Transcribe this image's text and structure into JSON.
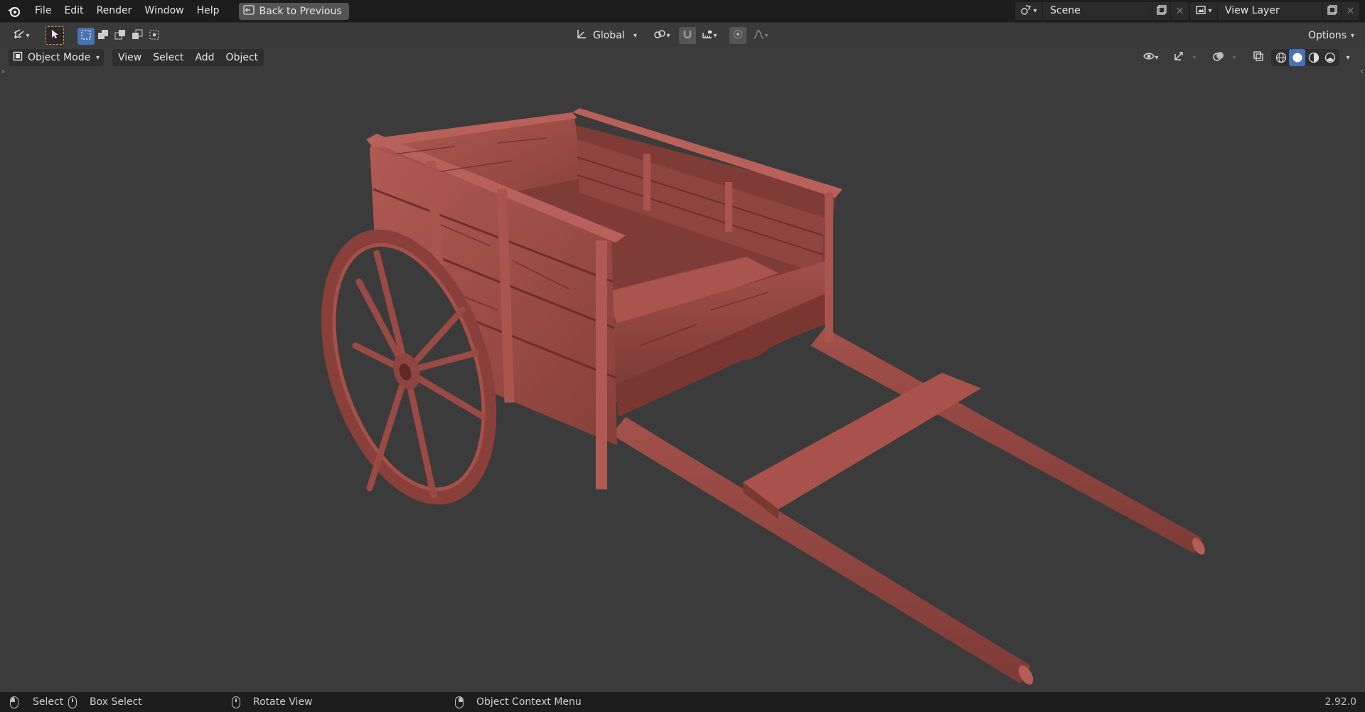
{
  "app": {
    "menu": [
      "File",
      "Edit",
      "Render",
      "Window",
      "Help"
    ],
    "back_button": "Back to Previous",
    "scene_name": "Scene",
    "view_layer_name": "View Layer",
    "version": "2.92.0"
  },
  "tool_header": {
    "transform_orientation": "Global",
    "options_label": "Options"
  },
  "viewport_header": {
    "mode": "Object Mode",
    "menus": [
      "View",
      "Select",
      "Add",
      "Object"
    ]
  },
  "statusbar": {
    "select": "Select",
    "box_select": "Box Select",
    "rotate_view": "Rotate View",
    "context_menu": "Object Context Menu"
  },
  "colors": {
    "model": "#9a4a44",
    "viewport_bg": "#3b3b3b",
    "active_blue": "#4772b3"
  }
}
